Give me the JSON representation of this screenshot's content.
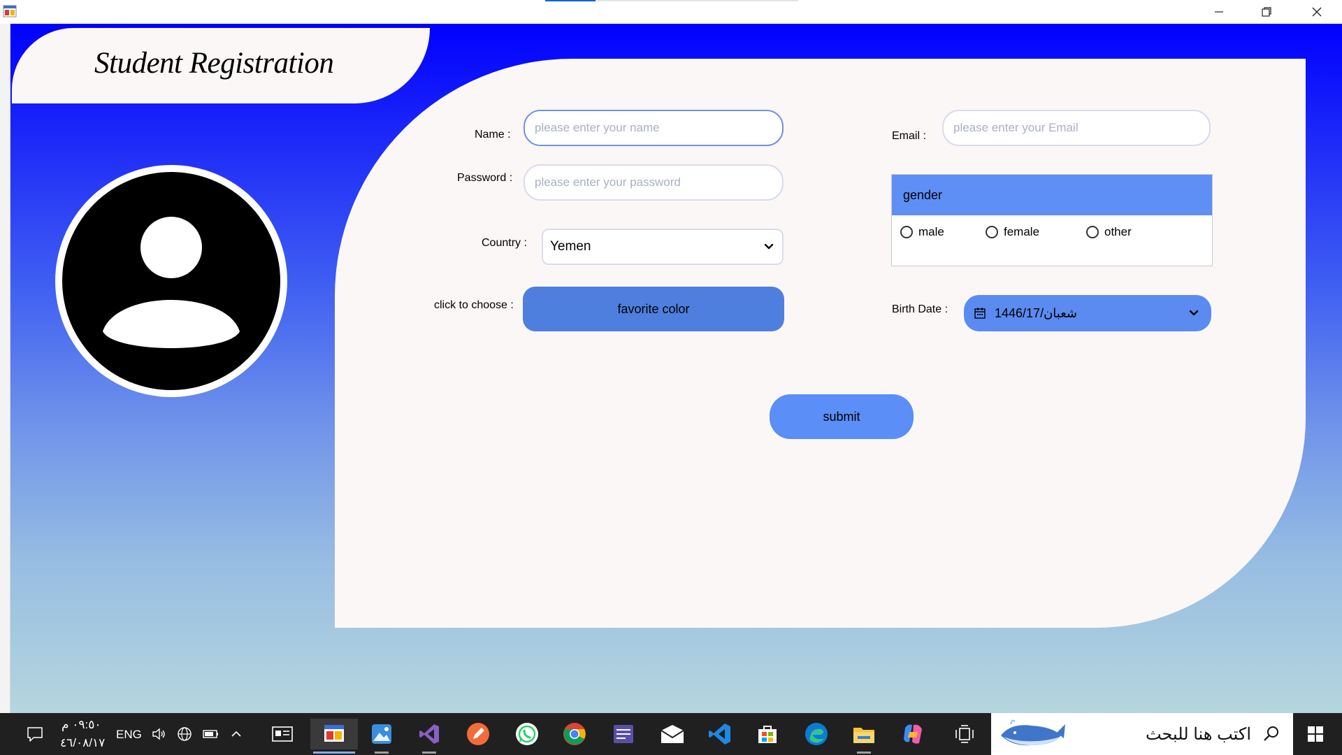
{
  "window": {
    "icon": "winforms-app-icon",
    "controls": [
      "minimize-icon",
      "restore-icon",
      "close-icon"
    ]
  },
  "form": {
    "title": "Student Registration",
    "avatar_icon": "user-profile-icon",
    "name": {
      "label": "Name :",
      "placeholder": "please enter your name"
    },
    "password": {
      "label": "Password :",
      "placeholder": "please enter your password"
    },
    "country": {
      "label": "Country :",
      "value": "Yemen"
    },
    "color": {
      "label": "click to choose :",
      "button": "favorite color"
    },
    "email": {
      "label": "Email :",
      "placeholder": "please enter your Email"
    },
    "gender": {
      "title": "gender",
      "options": [
        "male",
        "female",
        "other"
      ]
    },
    "birth_date": {
      "label": "Birth Date :",
      "value": "شعبان/1446/17"
    },
    "submit": "submit"
  },
  "taskbar": {
    "time": "٠٩:٥٠ م",
    "date": "٤٦/٠٨/١٧",
    "language": "ENG",
    "search_placeholder": "اكتب هنا للبحث",
    "apps": [
      "news-widget-icon",
      "winforms-app-icon",
      "photos-icon",
      "visual-studio-icon",
      "pen-app-icon",
      "whatsapp-icon",
      "chrome-icon",
      "tasks-app-icon",
      "mail-icon",
      "vscode-icon",
      "store-icon",
      "edge-icon",
      "file-explorer-icon",
      "copilot-icon",
      "task-view-icon"
    ]
  }
}
